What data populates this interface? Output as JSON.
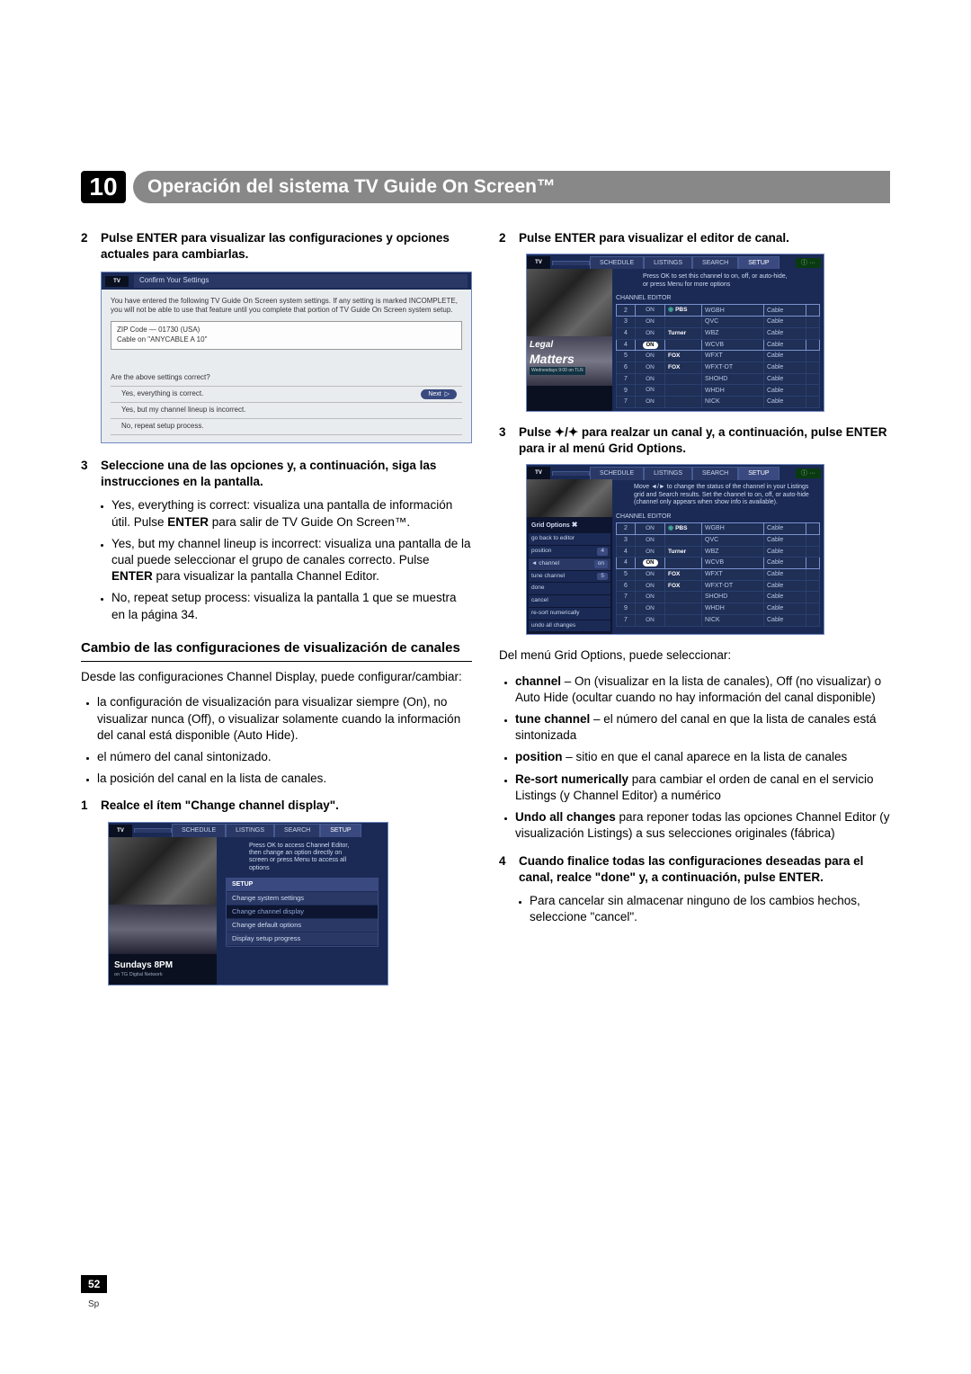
{
  "chapter": {
    "number": "10",
    "title": "Operación del sistema TV Guide On Screen™"
  },
  "left": {
    "s2": "Pulse ENTER para visualizar las configuraciones y opciones actuales para cambiarlas.",
    "confirm": {
      "title": "Confirm Your Settings",
      "msg": "You have entered the following TV Guide On Screen system settings. If any setting is marked INCOMPLETE, you will not be able to use that feature until you complete that portion of TV Guide On Screen system setup.",
      "line1": "ZIP Code — 01730 (USA)",
      "line2": "Cable on \"ANYCABLE A 10\"",
      "q": "Are the above settings correct?",
      "opt1": "Yes, everything is correct.",
      "opt2": "Yes, but my channel lineup is incorrect.",
      "opt3": "No, repeat setup process.",
      "next": "Next"
    },
    "s3": "Seleccione una de las opciones y, a continuación, siga las instrucciones en la pantalla.",
    "b1a": "Yes, everything is correct: visualiza una pantalla de información útil. Pulse ",
    "b1b": " para salir de TV Guide On Screen™.",
    "b2a": "Yes, but my channel lineup is incorrect: visualiza una pantalla de la cual puede seleccionar el grupo de canales correcto. Pulse ",
    "b2b": " para visualizar la pantalla Channel Editor.",
    "b3": "No, repeat setup process: visualiza la pantalla 1 que se muestra en la página 34.",
    "enter": "ENTER",
    "h3": "Cambio de las configuraciones de visualización de canales",
    "p1": "Desde las configuraciones Channel Display, puede configurar/cambiar:",
    "p1b1": "la configuración de visualización para visualizar siempre (On), no visualizar nunca (Off), o visualizar solamente cuando la información del canal está disponible (Auto Hide).",
    "p1b2": "el número del canal sintonizado.",
    "p1b3": "la posición del canal en la lista de canales.",
    "s1b": "Realce el ítem \"Change channel display\".",
    "setup": {
      "schedule": "SCHEDULE",
      "listings": "LISTINGS",
      "search": "SEARCH",
      "setup": "SETUP",
      "hint": "Press OK to access Channel Editor, then change an option directly on screen or press Menu to access all options",
      "header": "SETUP",
      "i1": "Change system settings",
      "i2": "Change channel display",
      "i3": "Change default options",
      "i4": "Display setup progress",
      "sun": "Sundays 8PM",
      "sunsub": "on TG Digital Network"
    }
  },
  "right": {
    "s2r": "Pulse ENTER para visualizar el editor de canal.",
    "ed": {
      "hint": "Press OK to set this channel to on, off, or auto-hide, or press Menu for more options",
      "title": "CHANNEL EDITOR",
      "left_title": "Legal",
      "left_title2": "Matters",
      "left_sub": "Wednesdays 9:00 on TLN",
      "schedule": "SCHEDULE",
      "listings": "LISTINGS",
      "search": "SEARCH",
      "setup": "SETUP",
      "rows": [
        {
          "n": "2",
          "on": true,
          "net": "PBS",
          "name": "WGBH",
          "src": "Cable",
          "sel": true,
          "dot": true
        },
        {
          "n": "3",
          "on": false,
          "net": "",
          "name": "QVC",
          "src": "Cable"
        },
        {
          "n": "4",
          "on": false,
          "net": "Turner",
          "name": "WBZ",
          "src": "Cable"
        },
        {
          "n": "4",
          "on": true,
          "net": "",
          "name": "WCVB",
          "src": "Cable",
          "badge": true
        },
        {
          "n": "5",
          "on": false,
          "net": "FOX",
          "name": "WFXT",
          "src": "Cable"
        },
        {
          "n": "6",
          "on": false,
          "net": "FOX",
          "name": "WFXT-DT",
          "src": "Cable"
        },
        {
          "n": "7",
          "on": false,
          "net": "",
          "name": "SHOHD",
          "src": "Cable"
        },
        {
          "n": "9",
          "on": false,
          "net": "",
          "name": "WHDH",
          "src": "Cable"
        },
        {
          "n": "7",
          "on": false,
          "net": "",
          "name": "NICK",
          "src": "Cable"
        }
      ]
    },
    "s3r_a": "Pulse ",
    "s3r_b": " para realzar un canal y, a continuación, pulse ENTER para ir al menú Grid Options.",
    "go": {
      "hint": "Move ◄/► to change the status of the channel in your Listings grid and Search results. Set the channel to on, off, or auto-hide (channel only appears when show info is available).",
      "panel_title": "Grid Options",
      "back": "go back to editor",
      "r1": "position",
      "v1": "4",
      "r2": "channel",
      "v2": "on",
      "r3": "tune channel",
      "v3": "5",
      "r4": "done",
      "r5": "cancel",
      "r6": "re-sort numerically",
      "r7": "undo all changes"
    },
    "p_intro": "Del menú Grid Options, puede seleccionar:",
    "gb1a": "channel",
    "gb1": " – On (visualizar en la lista de canales), Off (no visualizar) o Auto Hide (ocultar cuando no hay información del canal disponible)",
    "gb2a": "tune channel",
    "gb2": " – el número del canal en que la lista de canales está sintonizada",
    "gb3a": "position",
    "gb3": " – sitio en que el canal aparece en la lista de canales",
    "gb4a": "Re-sort numerically",
    "gb4": " para cambiar el orden de canal en el servicio Listings (y Channel Editor) a numérico",
    "gb5a": "Undo all changes",
    "gb5": " para reponer todas las opciones Channel Editor (y visualización Listings) a sus selecciones originales (fábrica)",
    "s4r": "Cuando finalice todas las configuraciones deseadas para el canal, realce \"done\" y, a continuación, pulse ENTER.",
    "s4r_b": "Para cancelar sin almacenar ninguno de los cambios hechos, seleccione \"cancel\"."
  },
  "on_label": "ON",
  "page_num": "52",
  "page_lang": "Sp"
}
